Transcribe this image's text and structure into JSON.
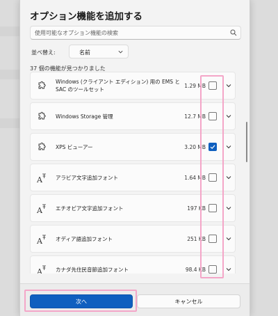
{
  "dialog": {
    "title": "オプション機能を追加する",
    "search": {
      "placeholder": "使用可能なオプション機能の検索"
    },
    "sort": {
      "label": "並べ替え:",
      "value": "名前"
    },
    "count_text": "37 個の機能が見つかりました",
    "features": [
      {
        "name": "Windows (クライアント エディション) 用の EMS と SAC のツールセット",
        "size": "1.29 MB",
        "checked": false,
        "icon": "puzzle-icon"
      },
      {
        "name": "Windows Storage 管理",
        "size": "12.7 MB",
        "checked": false,
        "icon": "puzzle-icon"
      },
      {
        "name": "XPS ビューアー",
        "size": "3.20 MB",
        "checked": true,
        "icon": "puzzle-icon"
      },
      {
        "name": "アラビア文字追加フォント",
        "size": "1.64 MB",
        "checked": false,
        "icon": "font-icon"
      },
      {
        "name": "エチオピア文字追加フォント",
        "size": "197 KB",
        "checked": false,
        "icon": "font-icon"
      },
      {
        "name": "オディア語追加フォント",
        "size": "251 KB",
        "checked": false,
        "icon": "font-icon"
      },
      {
        "name": "カナダ先住民音節追加フォント",
        "size": "98.4 KB",
        "checked": false,
        "icon": "font-icon"
      }
    ],
    "buttons": {
      "next": "次へ",
      "cancel": "キャンセル"
    },
    "colors": {
      "accent": "#0f5fbf",
      "highlight": "#f4a6c8"
    }
  }
}
